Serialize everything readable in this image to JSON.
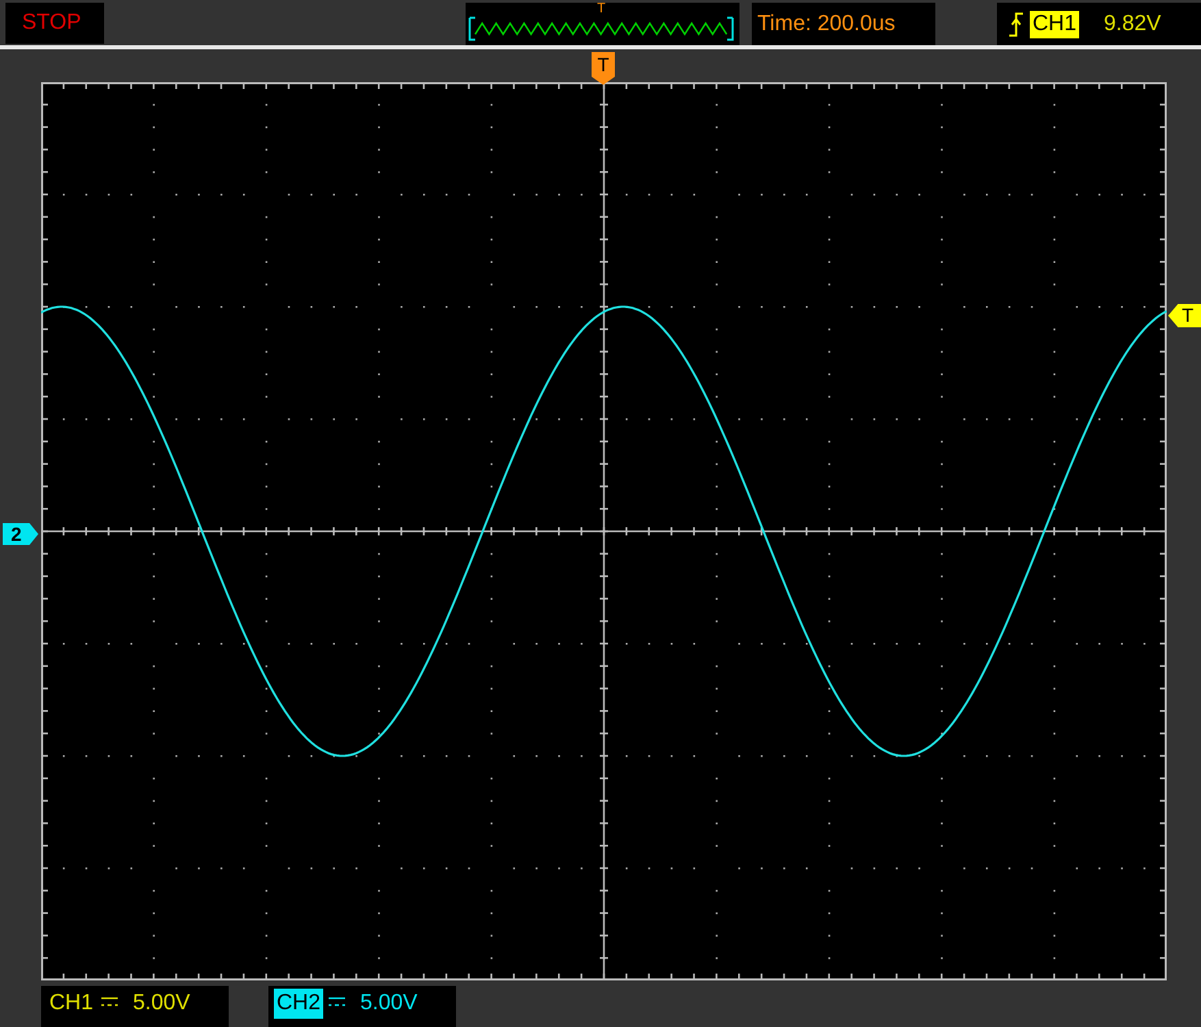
{
  "status": {
    "label": "STOP"
  },
  "trigger_preview": {
    "marker": "T"
  },
  "timebase": {
    "label": "Time: 200.0us"
  },
  "trigger": {
    "channel": "CH1",
    "level": "9.82V",
    "color": "#ffff00"
  },
  "screen_markers": {
    "trigger_position": "T",
    "channel_2_ground": "2",
    "trigger_level": "T"
  },
  "channels": [
    {
      "label": "CH1",
      "scale": "5.00V",
      "color": "#e0e000",
      "selected": false
    },
    {
      "label": "CH2",
      "scale": "5.00V",
      "color": "#00e5f0",
      "selected": true
    }
  ]
}
